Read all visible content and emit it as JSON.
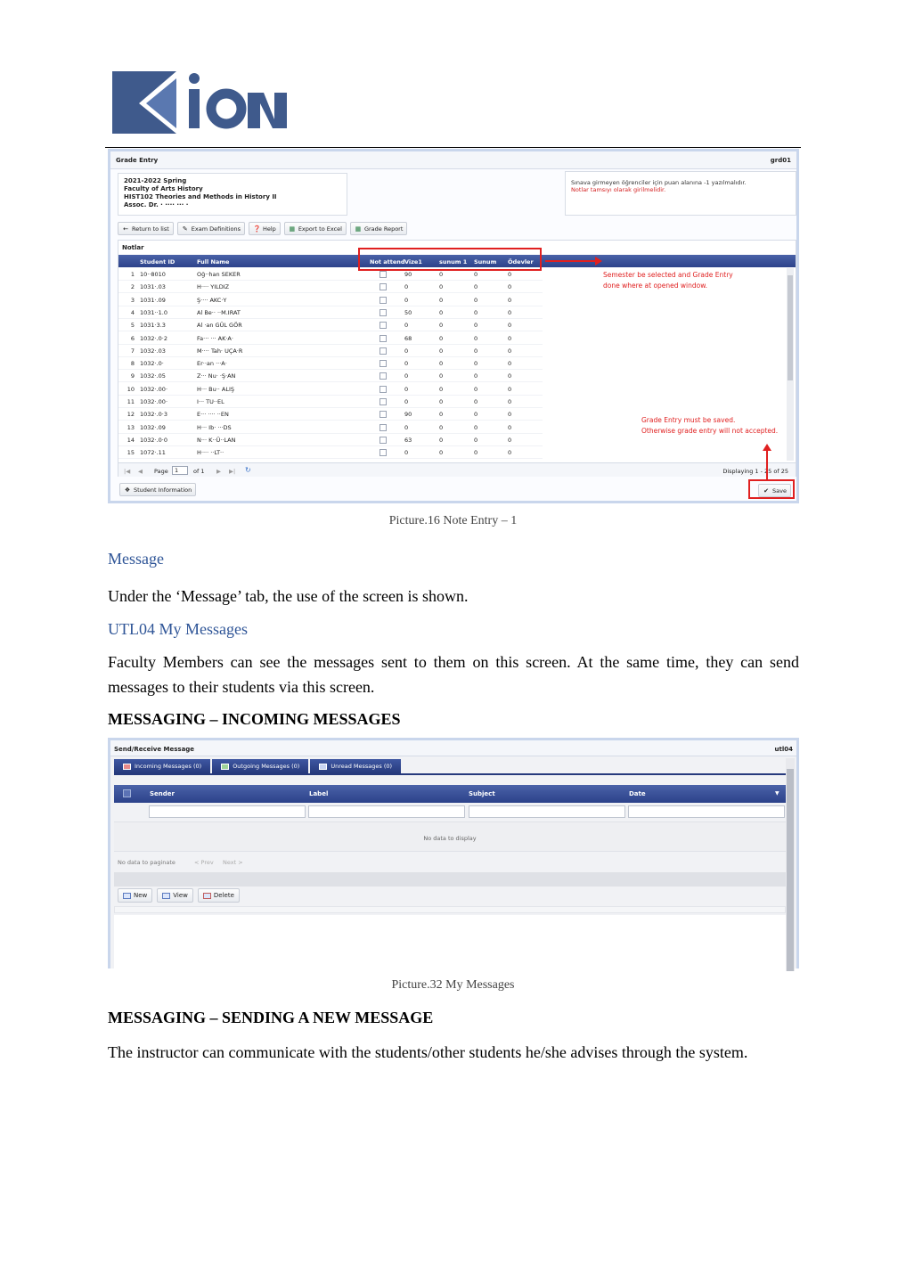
{
  "logo": {
    "text": "KION",
    "colors": {
      "primary": "#3f5a8c",
      "accent": "#5a78b0"
    }
  },
  "grade_entry": {
    "window_title": "Grade Entry",
    "window_code": "grd01",
    "course_info": [
      "2021-2022 Spring",
      "Faculty of Arts History",
      "HIST102 Theories and Methods in History II",
      "Assoc. Dr. · ···· ··· ·"
    ],
    "notice": [
      "Sınava girmeyen öğrenciler için puan alanına -1 yazılmalıdır.",
      "Notlar tamsıyı olarak girilmelidir."
    ],
    "toolbar": [
      {
        "icon": "arrow-left-icon",
        "label": "Return to list"
      },
      {
        "icon": "edit-icon",
        "label": "Exam Definitions"
      },
      {
        "icon": "help-icon",
        "label": "Help"
      },
      {
        "icon": "excel-icon",
        "label": "Export to Excel"
      },
      {
        "icon": "report-icon",
        "label": "Grade Report"
      }
    ],
    "panel_title": "Notlar",
    "columns": [
      "Student ID",
      "Full Name",
      "Not attend",
      "Vize1",
      "sunum 1",
      "Sunum",
      "Ödevler"
    ],
    "rows": [
      {
        "no": "1",
        "id": "10··8010",
        "name": "Oğ··han SEKER",
        "vize1": "90",
        "sunum1": "0",
        "sunum": "0",
        "odev": "0"
      },
      {
        "no": "2",
        "id": "1031·.03",
        "name": "H···· YILDIZ",
        "vize1": "0",
        "sunum1": "0",
        "sunum": "0",
        "odev": "0"
      },
      {
        "no": "3",
        "id": "1031·.09",
        "name": "Ş···· AKC·Y",
        "vize1": "0",
        "sunum1": "0",
        "sunum": "0",
        "odev": "0"
      },
      {
        "no": "4",
        "id": "1031··1.0",
        "name": "Al Be·· ··M.IRAT",
        "vize1": "50",
        "sunum1": "0",
        "sunum": "0",
        "odev": "0"
      },
      {
        "no": "5",
        "id": "1031·3.3",
        "name": "Al ·an GÜL GÖR",
        "vize1": "0",
        "sunum1": "0",
        "sunum": "0",
        "odev": "0"
      },
      {
        "no": "6",
        "id": "1032·.0·2",
        "name": "Fa··· ··· AK·A·",
        "vize1": "68",
        "sunum1": "0",
        "sunum": "0",
        "odev": "0"
      },
      {
        "no": "7",
        "id": "1032·.03",
        "name": "M···· Tah· UÇA·R",
        "vize1": "0",
        "sunum1": "0",
        "sunum": "0",
        "odev": "0"
      },
      {
        "no": "8",
        "id": "1032·.0·",
        "name": "Er··an ···A·",
        "vize1": "0",
        "sunum1": "0",
        "sunum": "0",
        "odev": "0"
      },
      {
        "no": "9",
        "id": "1032·.05",
        "name": "Z··· Nu· ·Ş·AN",
        "vize1": "0",
        "sunum1": "0",
        "sunum": "0",
        "odev": "0"
      },
      {
        "no": "10",
        "id": "1032·.00·",
        "name": "H··· Bu·· ALIŞ",
        "vize1": "0",
        "sunum1": "0",
        "sunum": "0",
        "odev": "0"
      },
      {
        "no": "11",
        "id": "1032·.00·",
        "name": "I··· TU··EL",
        "vize1": "0",
        "sunum1": "0",
        "sunum": "0",
        "odev": "0"
      },
      {
        "no": "12",
        "id": "1032·.0·3",
        "name": "E··· ···· ··EN",
        "vize1": "90",
        "sunum1": "0",
        "sunum": "0",
        "odev": "0"
      },
      {
        "no": "13",
        "id": "1032·.09",
        "name": "H··· Ib· ···DS",
        "vize1": "0",
        "sunum1": "0",
        "sunum": "0",
        "odev": "0"
      },
      {
        "no": "14",
        "id": "1032·.0·0",
        "name": "N··· K··Ü··LAN",
        "vize1": "63",
        "sunum1": "0",
        "sunum": "0",
        "odev": "0"
      },
      {
        "no": "15",
        "id": "1072·.11",
        "name": "H···· ··LT··",
        "vize1": "0",
        "sunum1": "0",
        "sunum": "0",
        "odev": "0"
      }
    ],
    "pager": {
      "page_label": "Page",
      "page_value": "1",
      "of_label": "of 1",
      "displaying": "Displaying 1 - 25 of 25"
    },
    "student_info_label": "Student Information",
    "save_label": "Save",
    "annotation_top": [
      "Semester be selected and Grade Entry",
      "done where at opened window."
    ],
    "annotation_bottom": [
      "Grade Entry must be saved.",
      "Otherwise grade entry will not accepted."
    ],
    "annotation_color": "#e02020"
  },
  "caption1": "Picture.16 Note Entry – 1",
  "heading_message": "Message",
  "para_message": "Under the ‘Message’ tab, the use of the screen is shown.",
  "heading_utl04": "UTL04 My Messages",
  "para_utl04": "Faculty Members can see the messages sent to them on this screen. At the same time, they can send messages to their students via this screen.",
  "heading_incoming": "MESSAGING – INCOMING MESSAGES",
  "messages": {
    "window_title": "Send/Receive Message",
    "window_code": "utl04",
    "tabs": [
      "Incoming Messages (0)",
      "Outgoing Messages (0)",
      "Unread Messages (0)"
    ],
    "columns": [
      "Sender",
      "Label",
      "Subject",
      "Date"
    ],
    "no_data": "No data to display",
    "pager": {
      "no_paginate": "No data to paginate",
      "prev": "< Prev",
      "next": "Next >"
    },
    "buttons": [
      "New",
      "View",
      "Delete"
    ]
  },
  "caption2": "Picture.32 My Messages",
  "heading_sending": "MESSAGING – SENDING A NEW MESSAGE",
  "para_sending": "The instructor can communicate with the students/other students he/she advises through the system."
}
